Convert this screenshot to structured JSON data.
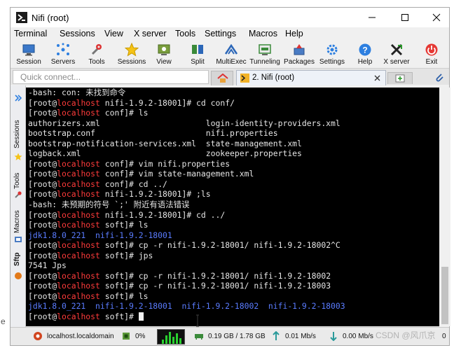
{
  "window": {
    "title": "Nifi (root)"
  },
  "menu": [
    "Terminal",
    "Sessions",
    "View",
    "X server",
    "Tools",
    "Settings",
    "Macros",
    "Help"
  ],
  "toolbar": {
    "items": [
      {
        "label": "Session",
        "icon": "monitor-icon"
      },
      {
        "label": "Servers",
        "icon": "network-icon"
      },
      {
        "label": "Tools",
        "icon": "wrench-icon"
      },
      {
        "label": "Sessions",
        "icon": "star-icon"
      },
      {
        "label": "View",
        "icon": "eye-icon"
      },
      {
        "label": "Split",
        "icon": "split-icon"
      },
      {
        "label": "MultiExec",
        "icon": "multiexec-icon"
      },
      {
        "label": "Tunneling",
        "icon": "tunnel-icon"
      },
      {
        "label": "Packages",
        "icon": "package-icon"
      },
      {
        "label": "Settings",
        "icon": "gear-icon"
      },
      {
        "label": "Help",
        "icon": "help-icon"
      },
      {
        "label": "X server",
        "icon": "x-server-icon"
      },
      {
        "label": "Exit",
        "icon": "power-icon"
      }
    ]
  },
  "quickconnect": {
    "placeholder": "Quick connect..."
  },
  "tabs": {
    "active_label": "2. Nifi (root)"
  },
  "sidebar": {
    "items": [
      "Sessions",
      "Tools",
      "Macros",
      "Sftp"
    ]
  },
  "terminal": {
    "lines": [
      {
        "text": "-bash: con: 未找到命令"
      },
      {
        "prompt": {
          "user": "root",
          "host": "localhost",
          "dir": "nifi-1.9.2-18001"
        },
        "text": " cd conf/"
      },
      {
        "prompt": {
          "user": "root",
          "host": "localhost",
          "dir": "conf"
        },
        "text": " ls"
      },
      {
        "text": "authorizers.xml                      login-identity-providers.xml"
      },
      {
        "text": "bootstrap.conf                       nifi.properties"
      },
      {
        "text": "bootstrap-notification-services.xml  state-management.xml"
      },
      {
        "text": "logback.xml                          zookeeper.properties"
      },
      {
        "prompt": {
          "user": "root",
          "host": "localhost",
          "dir": "conf"
        },
        "text": " vim nifi.properties"
      },
      {
        "prompt": {
          "user": "root",
          "host": "localhost",
          "dir": "conf"
        },
        "text": " vim state-management.xml"
      },
      {
        "prompt": {
          "user": "root",
          "host": "localhost",
          "dir": "conf"
        },
        "text": " cd ../"
      },
      {
        "prompt": {
          "user": "root",
          "host": "localhost",
          "dir": "nifi-1.9.2-18001"
        },
        "text": " ;ls"
      },
      {
        "text": "-bash: 未预期的符号 `;' 附近有语法错误"
      },
      {
        "prompt": {
          "user": "root",
          "host": "localhost",
          "dir": "nifi-1.9.2-18001"
        },
        "text": " cd ../"
      },
      {
        "prompt": {
          "user": "root",
          "host": "localhost",
          "dir": "soft"
        },
        "text": " ls"
      },
      {
        "blue": true,
        "text": "jdk1.8.0_221  nifi-1.9.2-18001"
      },
      {
        "prompt": {
          "user": "root",
          "host": "localhost",
          "dir": "soft"
        },
        "text": " cp -r nifi-1.9.2-18001/ nifi-1.9.2-18002^C"
      },
      {
        "prompt": {
          "user": "root",
          "host": "localhost",
          "dir": "soft"
        },
        "text": " jps"
      },
      {
        "text": "7541 Jps"
      },
      {
        "prompt": {
          "user": "root",
          "host": "localhost",
          "dir": "soft"
        },
        "text": " cp -r nifi-1.9.2-18001/ nifi-1.9.2-18002"
      },
      {
        "prompt": {
          "user": "root",
          "host": "localhost",
          "dir": "soft"
        },
        "text": " cp -r nifi-1.9.2-18001/ nifi-1.9.2-18003"
      },
      {
        "prompt": {
          "user": "root",
          "host": "localhost",
          "dir": "soft"
        },
        "text": " ls"
      },
      {
        "blue": true,
        "text": "jdk1.8.0_221  nifi-1.9.2-18001  nifi-1.9.2-18002  nifi-1.9.2-18003"
      },
      {
        "prompt": {
          "user": "root",
          "host": "localhost",
          "dir": "soft"
        },
        "text": " ",
        "cursor": true
      }
    ]
  },
  "statusbar": {
    "host": "localhost.localdomain",
    "cpu": "0%",
    "memory": "0.19 GB / 1.78 GB",
    "upload": "0.01 Mb/s",
    "download": "0.00 Mb/s",
    "extra": "0"
  },
  "watermark": "CSDN @风爪京",
  "left_edge_text": "e",
  "colors": {
    "terminal_bg": "#000000",
    "terminal_text": "#e6e6e6",
    "prompt_host": "#ff3b3b",
    "directory_blue": "#5a7cff"
  }
}
